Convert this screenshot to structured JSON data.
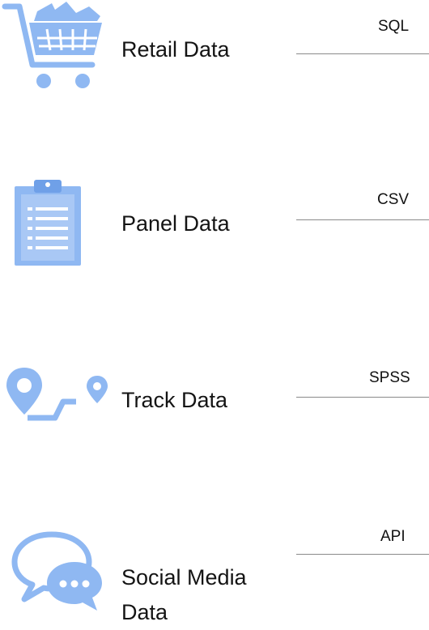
{
  "sources": [
    {
      "label": "Retail Data",
      "format": "SQL",
      "icon": "shopping-cart-icon"
    },
    {
      "label": "Panel Data",
      "format": "CSV",
      "icon": "clipboard-icon"
    },
    {
      "label": "Track Data",
      "format": "SPSS",
      "icon": "route-pin-icon"
    },
    {
      "label_line1": "Social Media",
      "label_line2": "Data",
      "format": "API",
      "icon": "chat-bubbles-icon"
    }
  ],
  "colors": {
    "icon": "#8fb8f2",
    "icon_dark": "#6fa0e8",
    "line": "#8a8a8a"
  }
}
